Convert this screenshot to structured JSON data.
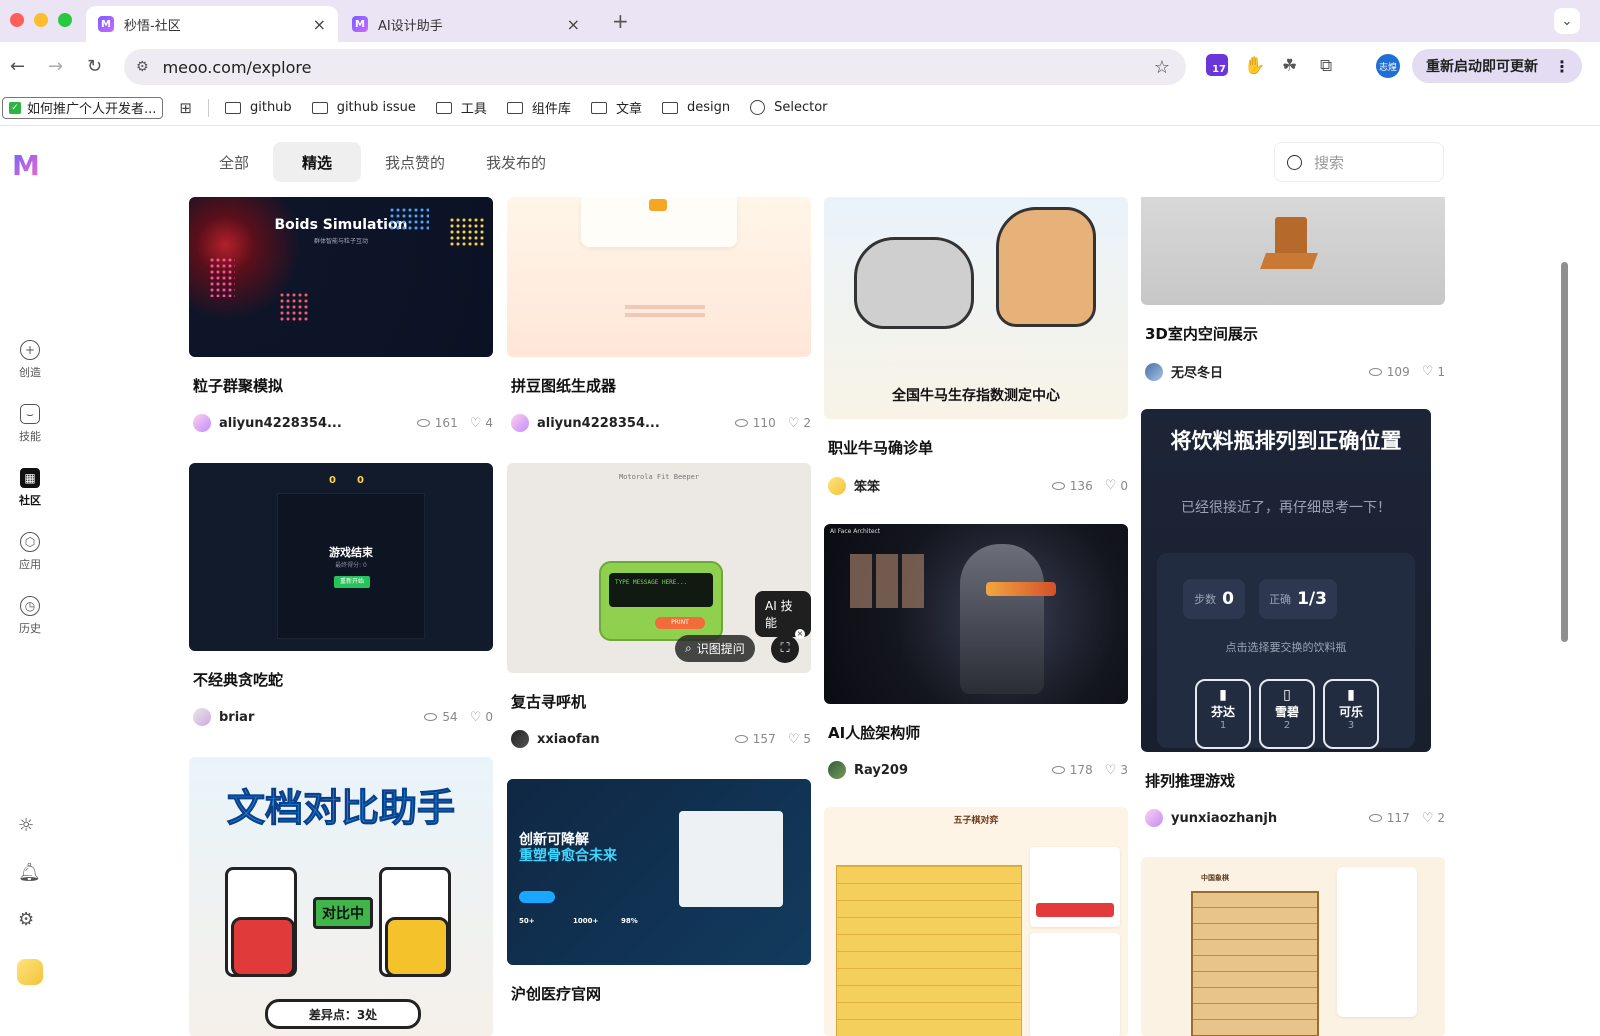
{
  "browser": {
    "tabs": [
      {
        "label": "秒悟-社区",
        "active": true
      },
      {
        "label": "AI设计助手",
        "active": false
      }
    ],
    "new_tab": "+",
    "url": "meoo.com/explore",
    "extension_badge": "17",
    "profile_text": "志煌",
    "update_label": "重新启动即可更新",
    "bookmarks": {
      "first": "如何推广个人开发者...",
      "items": [
        {
          "label": "github",
          "icon": "folder-icon"
        },
        {
          "label": "github issue",
          "icon": "folder-icon"
        },
        {
          "label": "工具",
          "icon": "folder-icon"
        },
        {
          "label": "组件库",
          "icon": "folder-icon"
        },
        {
          "label": "文章",
          "icon": "folder-icon"
        },
        {
          "label": "design",
          "icon": "folder-icon"
        },
        {
          "label": "Selector",
          "icon": "globe-icon"
        }
      ]
    }
  },
  "sidebar": {
    "logo": "M",
    "items": [
      {
        "label": "创造",
        "icon": "plus-circle-icon"
      },
      {
        "label": "技能",
        "icon": "bag-icon"
      },
      {
        "label": "社区",
        "icon": "grid-icon",
        "active": true
      },
      {
        "label": "应用",
        "icon": "cube-icon"
      },
      {
        "label": "历史",
        "icon": "clock-icon"
      }
    ],
    "bottom_icons": [
      "sun-icon",
      "bell-icon",
      "gear-icon"
    ]
  },
  "filters": {
    "tabs": [
      "全部",
      "精选",
      "我点赞的",
      "我发布的"
    ],
    "active": "精选"
  },
  "search": {
    "placeholder": "搜索"
  },
  "cards": [
    {
      "title": "粒子群聚模拟",
      "author": "aliyun4228354...",
      "views": "161",
      "likes": "4",
      "thumb_text": "Boids Simulation",
      "thumb_sub": "群体智能与粒子互动"
    },
    {
      "title": "拼豆图纸生成器",
      "author": "aliyun4228354...",
      "views": "110",
      "likes": "2"
    },
    {
      "title": "职业牛马确诊单",
      "author": "笨笨",
      "views": "136",
      "likes": "0",
      "thumb_text": "全国牛马生存指数测定中心"
    },
    {
      "title": "3D室内空间展示",
      "author": "无尽冬日",
      "views": "109",
      "likes": "1"
    },
    {
      "title": "不经典贪吃蛇",
      "author": "briar",
      "views": "54",
      "likes": "0",
      "thumb_text": "游戏结束",
      "thumb_sub": "最终得分: 0",
      "thumb_button": "重新开始",
      "thumb_scores": [
        "0",
        "0"
      ]
    },
    {
      "title": "复古寻呼机",
      "author": "xxiaofan",
      "views": "157",
      "likes": "5",
      "thumb_header": "Motorola Fit Beeper",
      "thumb_screen": "TYPE MESSAGE HERE...",
      "thumb_print": "PRINT",
      "tooltip": "AI 技能",
      "chip_label": "识图提问"
    },
    {
      "title": "AI人脸架构师",
      "author": "Ray209",
      "views": "178",
      "likes": "3",
      "thumb_text": "AI Face Architect"
    },
    {
      "title": "排列推理游戏",
      "author": "yunxiaozhanjh",
      "views": "117",
      "likes": "2",
      "thumb_title": "将饮料瓶排列到正确位置",
      "thumb_hint": "已经很接近了，再仔细思考一下！",
      "thumb_steps_label": "步数",
      "thumb_steps": "0",
      "thumb_correct_label": "正确",
      "thumb_correct": "1/3",
      "thumb_instruction": "点击选择要交换的饮料瓶",
      "thumb_bottles": [
        {
          "name": "芬达",
          "num": "1"
        },
        {
          "name": "雪碧",
          "num": "2"
        },
        {
          "name": "可乐",
          "num": "3"
        }
      ]
    },
    {
      "title": "",
      "thumb_text": "文档对比助手",
      "thumb_badge": "对比中",
      "thumb_footer": "差异点：3处"
    },
    {
      "title": "沪创医疗官网",
      "thumb_text": "创新可降解",
      "thumb_sub": "重塑骨愈合未来",
      "thumb_stats": [
        "50+",
        "1000+",
        "98%"
      ]
    },
    {
      "title": "",
      "thumb_text": "五子棋对弈"
    },
    {
      "title": "",
      "thumb_text": "中国象棋"
    }
  ],
  "colors": {
    "accent": "#6e62ff",
    "tab_strip": "#ebe4f4",
    "heart": "#888888"
  }
}
